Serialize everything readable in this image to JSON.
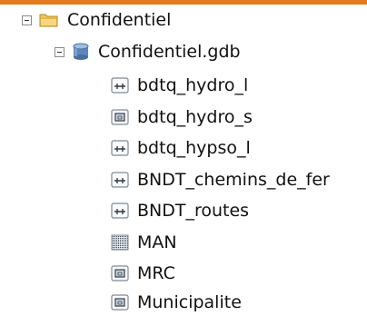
{
  "tree": {
    "root": {
      "label": "Confidentiel",
      "icon": "folder-icon",
      "expanded": true,
      "children": [
        {
          "label": "Confidentiel.gdb",
          "icon": "geodatabase-icon",
          "expanded": true,
          "layers": [
            {
              "label": "bdtq_hydro_l",
              "type": "line",
              "icon": "line-feature-class-icon"
            },
            {
              "label": "bdtq_hydro_s",
              "type": "polygon",
              "icon": "polygon-feature-class-icon"
            },
            {
              "label": "bdtq_hypso_l",
              "type": "line",
              "icon": "line-feature-class-icon"
            },
            {
              "label": "BNDT_chemins_de_fer",
              "type": "line",
              "icon": "line-feature-class-icon"
            },
            {
              "label": "BNDT_routes",
              "type": "line",
              "icon": "line-feature-class-icon"
            },
            {
              "label": "MAN",
              "type": "raster",
              "icon": "raster-icon"
            },
            {
              "label": "MRC",
              "type": "polygon",
              "icon": "polygon-feature-class-icon"
            },
            {
              "label": "Municipalite",
              "type": "polygon",
              "icon": "polygon-feature-class-icon"
            }
          ]
        }
      ]
    }
  },
  "colors": {
    "accent_bar": "#e07b1f",
    "folder": "#f1c75b",
    "database": "#5e86b8"
  }
}
